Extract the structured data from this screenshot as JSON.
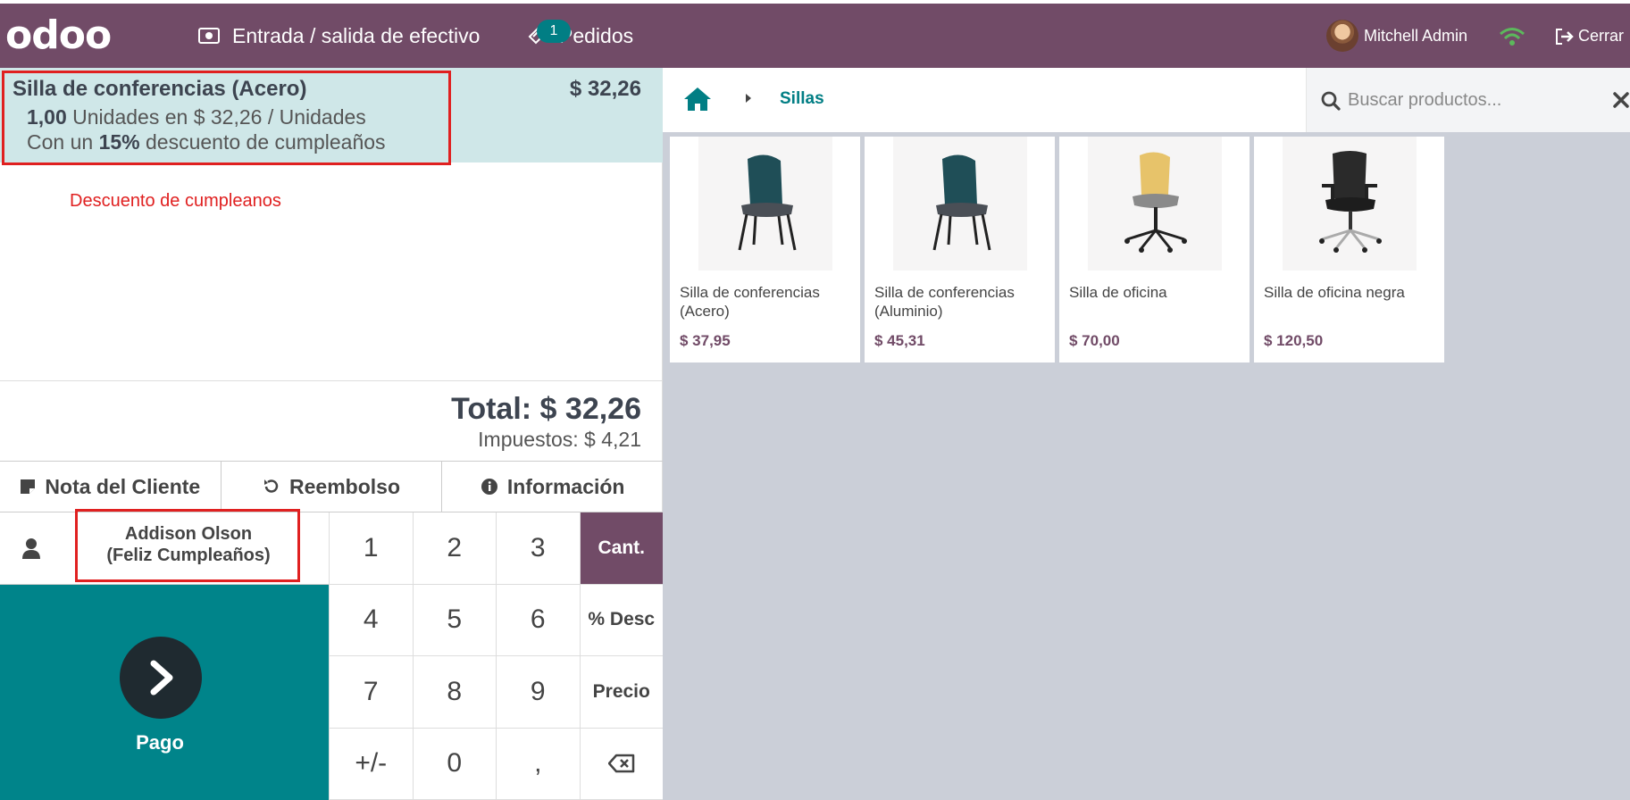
{
  "topbar": {
    "logo": "odoo",
    "cash_label": "Entrada / salida de efectivo",
    "orders_label": "Pedidos",
    "orders_count": "1",
    "user_name": "Mitchell Admin",
    "close_label": "Cerrar"
  },
  "order": {
    "line": {
      "product": "Silla de conferencias (Acero)",
      "price": "$ 32,26",
      "qty": "1,00",
      "qty_text": "Unidades en $ 32,26 / Unidades",
      "disc_prefix": "Con un",
      "disc_value": "15%",
      "disc_suffix": "descuento de cumpleaños"
    },
    "annotation": "Descuento de cumpleanos",
    "total": "Total: $ 32,26",
    "taxes": "Impuestos: $ 4,21"
  },
  "actions": {
    "note": "Nota del Cliente",
    "refund": "Reembolso",
    "info": "Información"
  },
  "customer": {
    "name": "Addison Olson",
    "tag": "(Feliz Cumpleaños)"
  },
  "payment": {
    "label": "Pago"
  },
  "numpad": {
    "k1": "1",
    "k2": "2",
    "k3": "3",
    "qty": "Cant.",
    "k4": "4",
    "k5": "5",
    "k6": "6",
    "disc": "% Desc",
    "k7": "7",
    "k8": "8",
    "k9": "9",
    "price": "Precio",
    "sign": "+/-",
    "k0": "0",
    "comma": ","
  },
  "products_panel": {
    "category": "Sillas",
    "search_placeholder": "Buscar productos...",
    "items": [
      {
        "name": "Silla de conferencias (Acero)",
        "price": "$ 37,95"
      },
      {
        "name": "Silla de conferencias (Aluminio)",
        "price": "$ 45,31"
      },
      {
        "name": "Silla de oficina",
        "price": "$ 70,00"
      },
      {
        "name": "Silla de oficina negra",
        "price": "$ 120,50"
      }
    ]
  },
  "colors": {
    "brand": "#714B67",
    "teal": "#00848a",
    "highlight": "#e02020"
  }
}
